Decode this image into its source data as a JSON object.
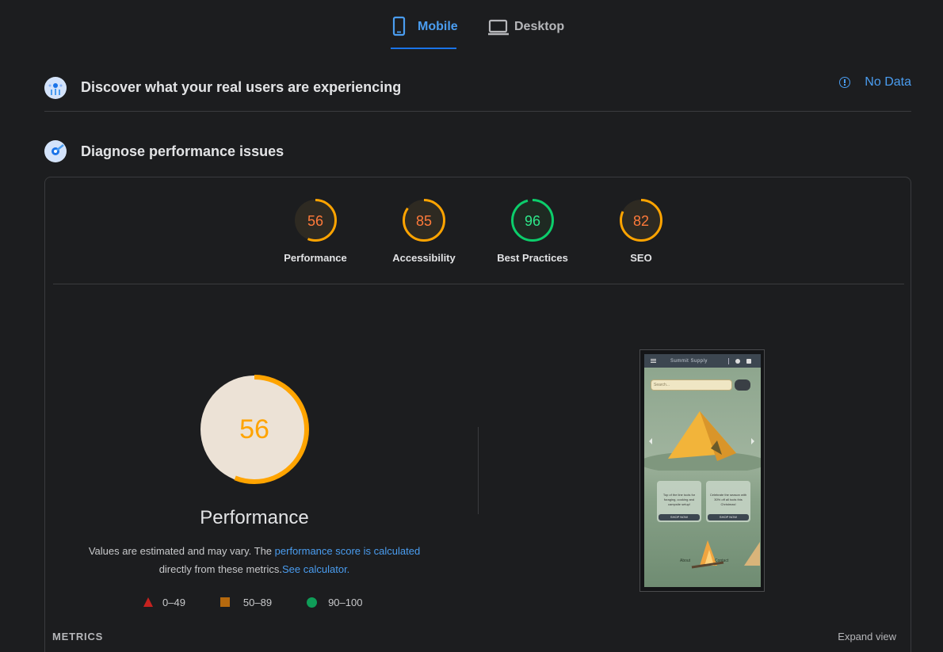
{
  "tabs": [
    {
      "label": "Mobile",
      "icon": "phone-icon",
      "active": true
    },
    {
      "label": "Desktop",
      "icon": "laptop-icon",
      "active": false
    }
  ],
  "real_users": {
    "title": "Discover what your real users are experiencing",
    "status": "No Data",
    "icon": "crux-icon"
  },
  "diagnose": {
    "title": "Diagnose performance issues",
    "icon": "lighthouse-icon"
  },
  "categories": [
    {
      "label": "Performance",
      "score": "56",
      "color": "#ffa400"
    },
    {
      "label": "Accessibility",
      "score": "85",
      "color": "#ffa400"
    },
    {
      "label": "Best Practices",
      "score": "96",
      "color": "#0cce6b"
    },
    {
      "label": "SEO",
      "score": "82",
      "color": "#ffa400"
    }
  ],
  "performance": {
    "score": "56",
    "title": "Performance",
    "note_text_1": "Values are estimated and may vary. The ",
    "note_link_1": "performance score is calculated",
    "note_text_2": " directly from these metrics.",
    "note_link_2": "See calculator."
  },
  "legend": [
    {
      "range": "0–49",
      "shape": "triangle",
      "color": "#c5221f"
    },
    {
      "range": "50–89",
      "shape": "square",
      "color": "#b5690e"
    },
    {
      "range": "90–100",
      "shape": "circle",
      "color": "#0f9d58"
    }
  ],
  "screenshot": {
    "brand": "Summit Supply",
    "search_placeholder": "Search...",
    "card1_text": "Top of the line tools for foraging, cooking and campsite setup!",
    "card2_text": "Celebrate the season with 30% off all tools this Christmas!",
    "shop_label": "SHOP NOW",
    "footer_about": "About",
    "footer_contact": "Contact"
  },
  "metrics": {
    "heading": "METRICS",
    "expand_label": "Expand view"
  }
}
